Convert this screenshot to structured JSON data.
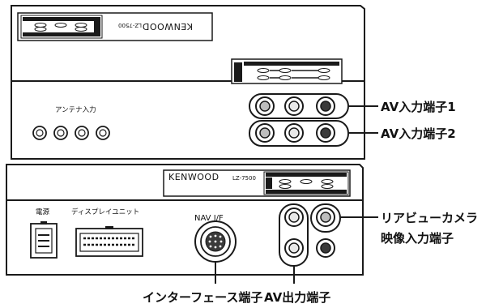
{
  "device": {
    "brand": "KENWOOD",
    "model": "LZ-7500"
  },
  "top_unit": {
    "antenna_label": "アンテナ入力"
  },
  "bottom_unit": {
    "power_label": "電源",
    "display_label": "ディスプレイユニット",
    "nav_label": "NAV I/F"
  },
  "callouts": {
    "av_input_1": "AV入力端子1",
    "av_input_2": "AV入力端子2",
    "rear_view_camera_line1": "リアビューカメラ",
    "rear_view_camera_line2": "映像入力端子",
    "interface": "インターフェース端子",
    "av_output": "AV出力端子"
  },
  "colors": {
    "line": "#1a1a1a",
    "jack_light": "#cfcfcf",
    "jack_dark": "#3a3a3a",
    "panel": "#ffffff"
  }
}
